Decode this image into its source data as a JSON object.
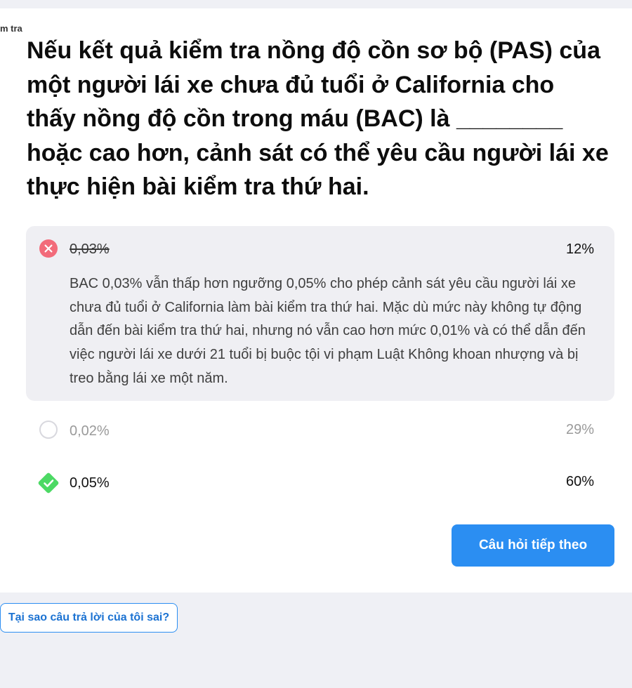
{
  "breadcrumb": {
    "text": "m tra"
  },
  "question": {
    "text": "Nếu kết quả kiểm tra nồng độ cồn sơ bộ (PAS) của một người lái xe chưa đủ tuổi ở California cho thấy nồng độ cồn trong máu (BAC) là ________ hoặc cao hơn, cảnh sát có thể yêu cầu người lái xe thực hiện bài kiểm tra thứ hai."
  },
  "options": [
    {
      "label": "0,03%",
      "percent": "12%",
      "state": "wrong-selected",
      "explanation": "BAC 0,03% vẫn thấp hơn ngưỡng 0,05% cho phép cảnh sát yêu cầu người lái xe chưa đủ tuổi ở California làm bài kiểm tra thứ hai. Mặc dù mức này không tự động dẫn đến bài kiểm tra thứ hai, nhưng nó vẫn cao hơn mức 0,01% và có thể dẫn đến việc người lái xe dưới 21 tuổi bị buộc tội vi phạm Luật Không khoan nhượng và bị treo bằng lái xe một năm."
    },
    {
      "label": "0,02%",
      "percent": "29%",
      "state": "unselected"
    },
    {
      "label": "0,05%",
      "percent": "60%",
      "state": "correct"
    }
  ],
  "buttons": {
    "next": "Câu hỏi tiếp theo",
    "why_wrong": "Tại sao câu trả lời của tôi sai?"
  },
  "colors": {
    "wrong": "#f26b7a",
    "correct": "#4cd964",
    "primary": "#2b8ef2",
    "muted_text": "#9a9a9a"
  },
  "icons": {
    "wrong": "close-circle-icon",
    "unselected": "radio-empty-icon",
    "correct": "check-diamond-icon"
  }
}
